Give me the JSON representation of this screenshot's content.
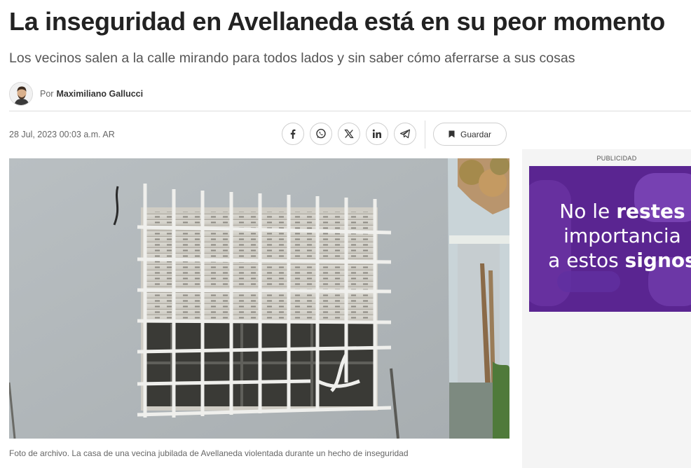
{
  "article": {
    "headline": "La inseguridad en Avellaneda está en su peor momento",
    "subheadline": "Los vecinos salen a la calle mirando para todos lados y sin saber cómo aferrarse a sus cosas",
    "byline_prefix": "Por",
    "author": "Maximiliano Gallucci",
    "date": "28 Jul, 2023 00:03 a.m. AR",
    "image_caption": "Foto de archivo. La casa de una vecina jubilada de Avellaneda violentada durante un hecho de inseguridad"
  },
  "share": {
    "icons": [
      "facebook-icon",
      "whatsapp-icon",
      "x-icon",
      "linkedin-icon",
      "telegram-icon"
    ],
    "save_label": "Guardar"
  },
  "ad": {
    "label": "PUBLICIDAD",
    "line1_regular": "No le ",
    "line1_bold": "restes",
    "line2": "importancia",
    "line3_regular": "a estos ",
    "line3_bold": "signos"
  },
  "colors": {
    "ad_purple": "#5a2591",
    "text_dark": "#222222",
    "text_muted": "#666666"
  }
}
